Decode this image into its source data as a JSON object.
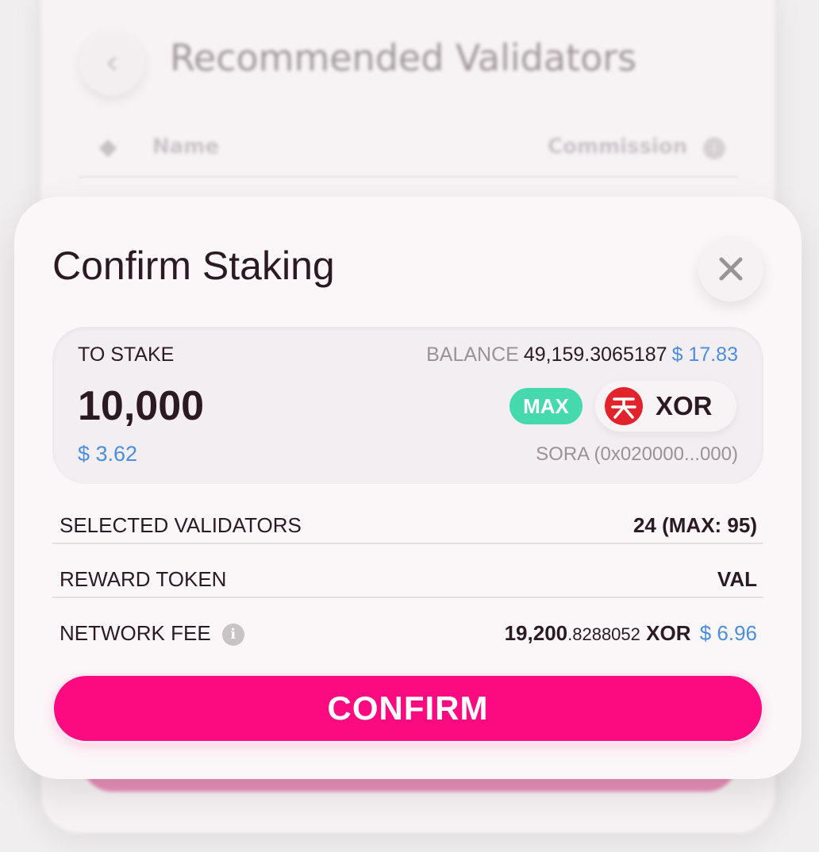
{
  "background": {
    "back_icon": "chevron-left-icon",
    "title": "Recommended Validators",
    "col_name": "Name",
    "col_commission": "Commission",
    "info_icon": "info-icon"
  },
  "modal": {
    "title": "Confirm Staking",
    "close_icon": "close-icon",
    "stake": {
      "label": "TO STAKE",
      "balance_label": "BALANCE",
      "balance_value": "49,159.3065187",
      "balance_usd": "$ 17.83",
      "amount": "10,000",
      "amount_usd": "$ 3.62",
      "max_label": "MAX",
      "token_symbol": "XOR",
      "token_icon": "xor-token-icon",
      "token_network": "SORA (0x020000...000)"
    },
    "rows": {
      "validators_label": "SELECTED VALIDATORS",
      "validators_value": "24 (MAX: 95)",
      "reward_label": "REWARD TOKEN",
      "reward_value": "VAL",
      "fee_label": "NETWORK FEE",
      "fee_info_icon": "info-icon",
      "fee_integer": "19,200",
      "fee_decimal": ".8288052",
      "fee_token": "XOR",
      "fee_usd": "$ 6.96"
    },
    "confirm_label": "CONFIRM"
  },
  "colors": {
    "accent_pink": "#fc0a80",
    "max_green": "#45d9ad",
    "usd_blue": "#4a8ee0",
    "xor_red": "#e3232c",
    "text_dark": "#2b1a22"
  }
}
